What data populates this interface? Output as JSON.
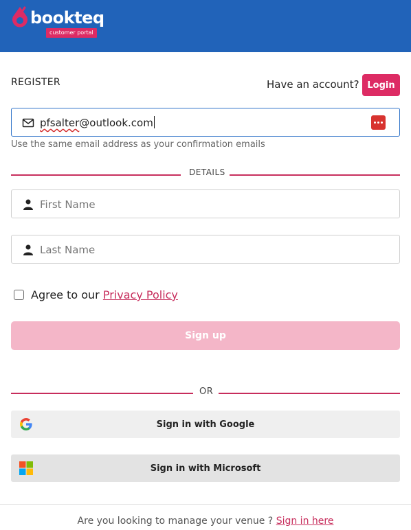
{
  "brand": {
    "name": "bookteq",
    "badge": "customer portal",
    "colors": {
      "header": "#2163b9",
      "accent": "#dd2b64"
    }
  },
  "register": {
    "title": "REGISTER",
    "have_account": "Have an account?",
    "login_label": "Login"
  },
  "email": {
    "value_misspelled": "pfsalter",
    "value_rest": "@outlook.com",
    "hint": "Use the same email address as your confirmation emails"
  },
  "details": {
    "divider": "DETAILS",
    "first_name_placeholder": "First Name",
    "last_name_placeholder": "Last Name"
  },
  "agree": {
    "prefix": "Agree to our",
    "link": "Privacy Policy",
    "checked": false
  },
  "signup_label": "Sign up",
  "or_divider": "OR",
  "social": {
    "google_label": "Sign in with Google",
    "microsoft_label": "Sign in with Microsoft"
  },
  "footer": {
    "text": "Are you looking to manage your venue ?",
    "link": "Sign in here"
  }
}
